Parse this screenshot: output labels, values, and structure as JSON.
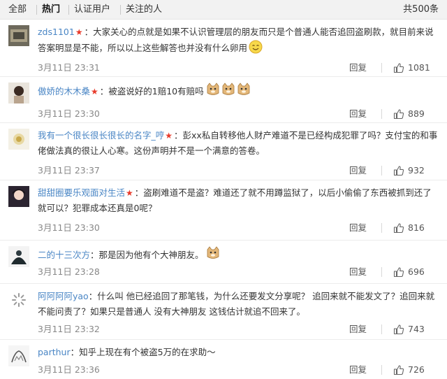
{
  "tabs": {
    "all": "全部",
    "hot": "热门",
    "verified": "认证用户",
    "following": "关注的人",
    "total": "共500条"
  },
  "comments": [
    {
      "username": "zds1101",
      "text": "：大家关心的点就是如果不认识管理层的朋友而只是个普通人能否追回盗刷款，就目前来说答案明显是不能，所以以上这些解答也并没有什么卵用",
      "time": "3月11日 23:31",
      "reply": "回复",
      "likes": "1081",
      "emoji": "smile"
    },
    {
      "username": "傲娇的木木桑",
      "text": "：被盗说好的1赔10有赔吗",
      "time": "3月11日 23:30",
      "reply": "回复",
      "likes": "889",
      "emoji": "doge x3"
    },
    {
      "username": "我有一个很长很长很长的名字_哼",
      "text": "：彭xx私自转移他人财产难道不是已经构成犯罪了吗？支付宝的和事佬做法真的很让人心寒。这份声明并不是一个满意的答卷。",
      "time": "3月11日 23:37",
      "reply": "回复",
      "likes": "932"
    },
    {
      "username": "甜甜圈要乐观面对生活",
      "text": "：盗刷难道不是盗？难道还了就不用蹲监狱了，以后小偷偷了东西被抓到还了就可以？犯罪成本还真是0呢？",
      "time": "3月11日 23:30",
      "reply": "回复",
      "likes": "816"
    },
    {
      "username": "二的十三次方",
      "text": "：那是因为他有个大神朋友。",
      "time": "3月11日 23:28",
      "reply": "回复",
      "likes": "696",
      "emoji": "doge"
    },
    {
      "username": "阿阿阿阿yao",
      "text": "：什么叫 他已经追回了那笔钱，为什么还要发文分享呢？ 追回来就不能发文了？追回来就不能问责了？如果只是普通人 没有大神朋友 这钱估计就追不回来了。",
      "time": "3月11日 23:32",
      "reply": "回复",
      "likes": "743"
    },
    {
      "username": "parthur",
      "text": "：知乎上现在有个被盗5万的在求助～",
      "time": "3月11日 23:36",
      "reply": "回复",
      "likes": "726"
    }
  ],
  "colors": {
    "username": "#4a86c5",
    "star": "#e83a2a",
    "meta": "#888888",
    "tab_bg": "#f2f2f2"
  }
}
